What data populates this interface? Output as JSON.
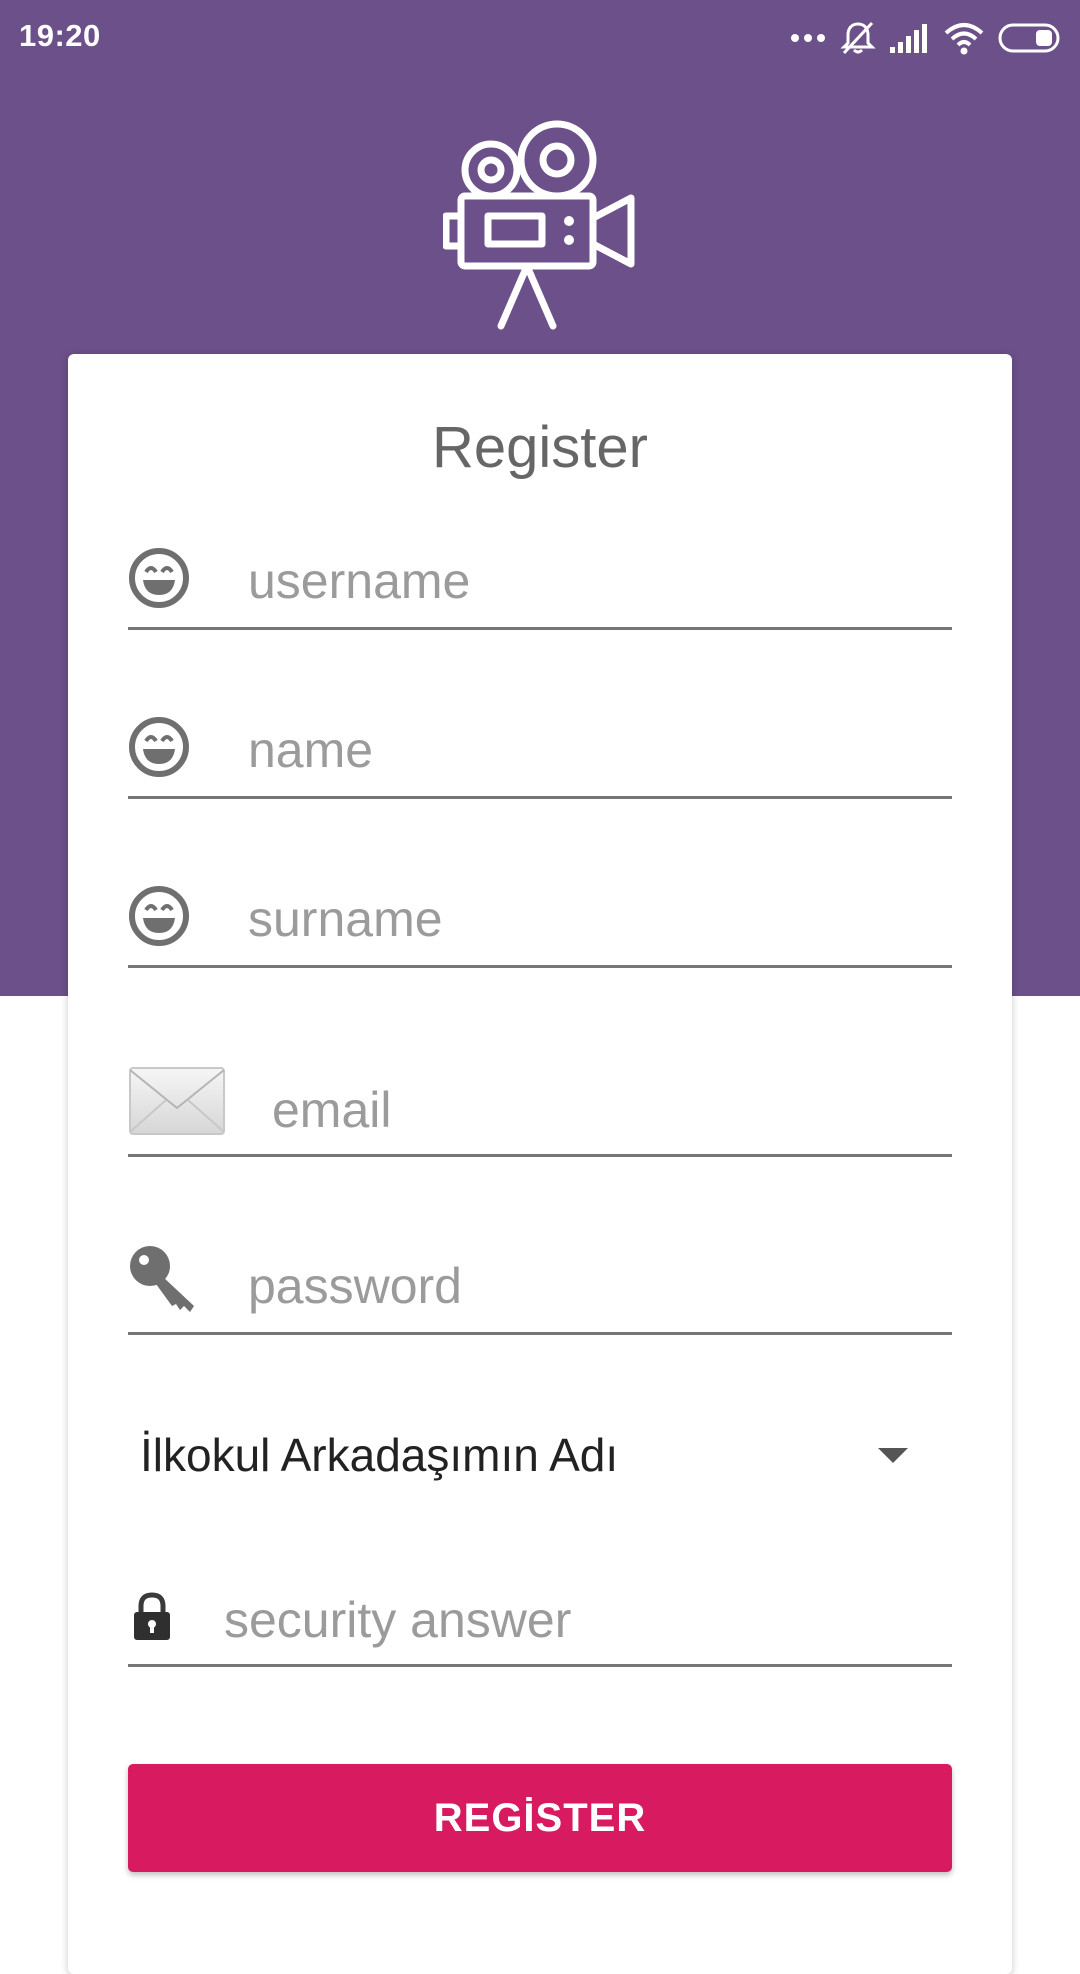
{
  "status_bar": {
    "time": "19:20",
    "icons": [
      "more-dots-icon",
      "notifications-off-icon",
      "signal-icon",
      "wifi-icon",
      "battery-icon"
    ]
  },
  "header": {
    "logo_icon": "movie-camera-icon",
    "background_color": "#6b5089"
  },
  "form": {
    "title": "Register",
    "fields": {
      "username": {
        "placeholder": "username",
        "icon": "smiley-icon"
      },
      "name": {
        "placeholder": "name",
        "icon": "smiley-icon"
      },
      "surname": {
        "placeholder": "surname",
        "icon": "smiley-icon"
      },
      "email": {
        "placeholder": "email",
        "icon": "envelope-icon"
      },
      "password": {
        "placeholder": "password",
        "icon": "key-icon"
      },
      "security_answer": {
        "placeholder": "security answer",
        "icon": "lock-icon"
      }
    },
    "security_question": {
      "selected": "İlkokul Arkadaşımın Adı"
    },
    "register_button": {
      "label": "REGİSTER",
      "color": "#d81b60"
    }
  }
}
